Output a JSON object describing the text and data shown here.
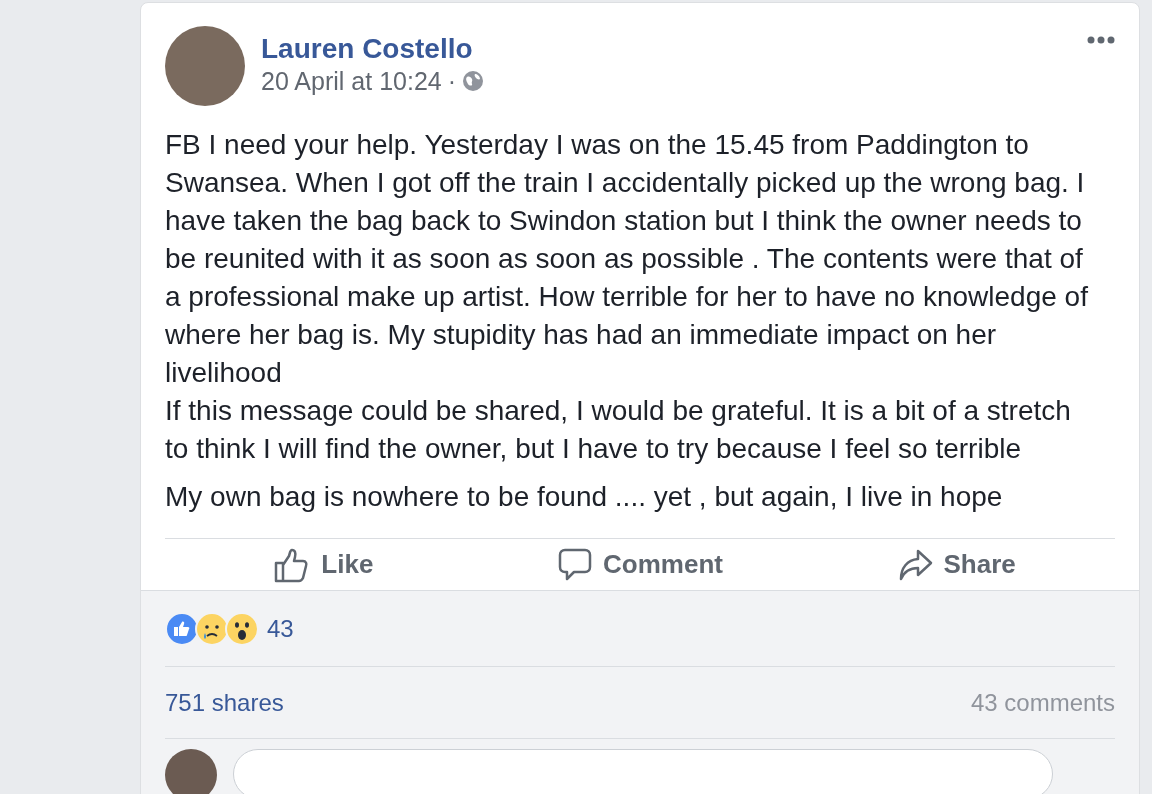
{
  "post": {
    "author": "Lauren Costello",
    "timestamp": "20 April at 10:24",
    "separator": "·",
    "paragraphs": [
      "FB I need your help. Yesterday I was on the 15.45 from Paddington to Swansea. When I got off the train I accidentally picked up the wrong bag. I have taken the bag back to Swindon station but I think the owner needs to be reunited with it as soon as soon as possible . The contents were that of a professional make up artist. How terrible for her to have no knowledge of where her bag is. My stupidity has had an immediate impact on her livelihood\nIf this message could be shared, I would be grateful. It is a bit of a stretch to think I will find the owner, but I have to try because I feel so terrible",
      "My own bag is nowhere to be found .... yet , but again, I live in hope"
    ]
  },
  "actions": [
    {
      "kind": "like",
      "label": "Like"
    },
    {
      "kind": "comment",
      "label": "Comment"
    },
    {
      "kind": "share",
      "label": "Share"
    }
  ],
  "reactions": {
    "kinds": [
      {
        "kind": "like"
      },
      {
        "kind": "sad"
      },
      {
        "kind": "wow"
      }
    ],
    "count": "43"
  },
  "shares": "751 shares",
  "comments": "43 comments"
}
